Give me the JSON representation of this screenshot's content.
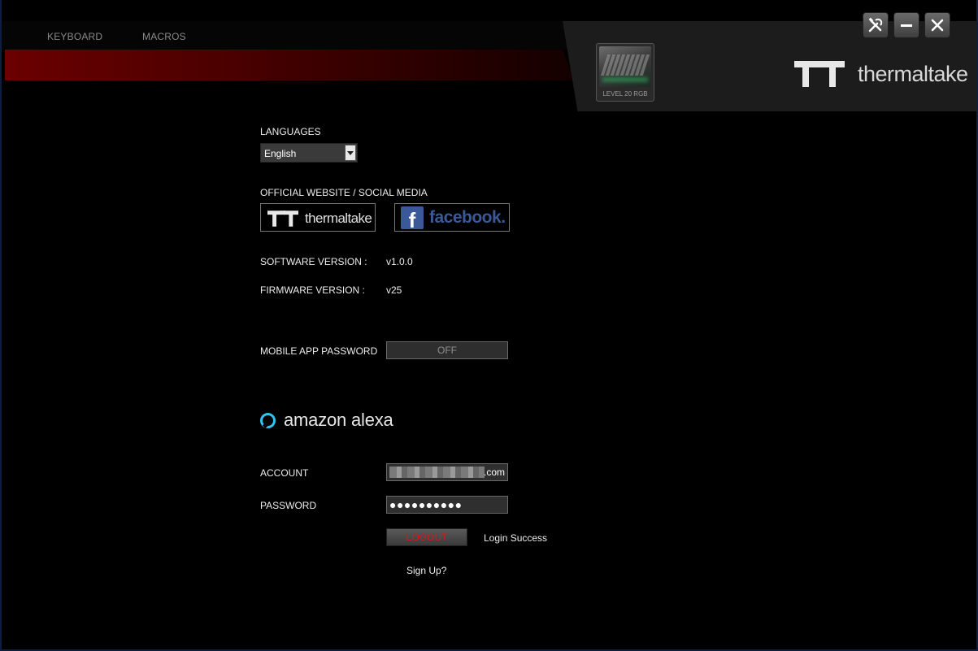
{
  "nav": {
    "tabs": [
      "KEYBOARD",
      "MACROS"
    ]
  },
  "device": {
    "label": "LEVEL 20 RGB"
  },
  "brand": {
    "wordmark": "thermaltake"
  },
  "window_controls": {
    "icons": [
      "tools-icon",
      "minimize-icon",
      "close-icon"
    ]
  },
  "settings": {
    "languages_label": "LANGUAGES",
    "language_value": "English",
    "social_label": "OFFICIAL WEBSITE / SOCIAL MEDIA",
    "thermaltake_link_text": "thermaltake",
    "facebook_link_text": "facebook",
    "software_version_label": "SOFTWARE VERSION :",
    "software_version_value": "v1.0.0",
    "firmware_version_label": "FIRMWARE VERSION :",
    "firmware_version_value": "v25",
    "mobile_password_label": "MOBILE APP PASSWORD",
    "mobile_password_toggle": "OFF"
  },
  "alexa": {
    "brand_text": "amazon alexa",
    "account_label": "ACCOUNT",
    "account_suffix": ".com",
    "password_label": "PASSWORD",
    "password_mask": "●●●●●●●●●●",
    "logout_label": "LOGOUT",
    "login_status": "Login Success",
    "signup_link": "Sign Up?"
  },
  "colors": {
    "accent_red": "#6b0000",
    "alexa_blue": "#31c4f3",
    "facebook_blue": "#3b5998",
    "logout_red": "#d81818"
  }
}
